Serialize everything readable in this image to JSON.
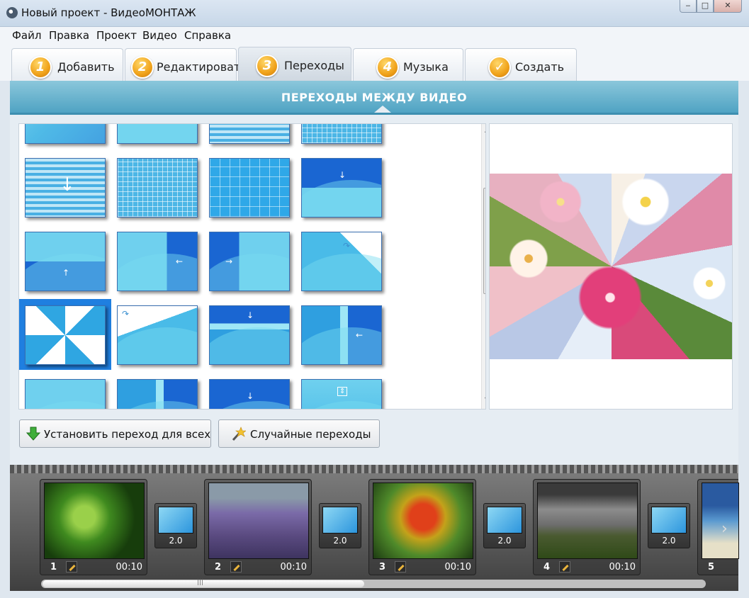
{
  "window": {
    "title": "Новый проект - ВидеоМОНТАЖ",
    "controls": {
      "minimize": "‒",
      "maximize": "□",
      "close": "✕"
    }
  },
  "menu": [
    "Файл",
    "Правка",
    "Проект",
    "Видео",
    "Справка"
  ],
  "tabs": [
    {
      "num": "1",
      "label": "Добавить",
      "active": false
    },
    {
      "num": "2",
      "label": "Редактировать",
      "active": false
    },
    {
      "num": "3",
      "label": "Переходы",
      "active": true
    },
    {
      "num": "4",
      "label": "Музыка",
      "active": false
    },
    {
      "num": "✓",
      "label": "Создать",
      "active": false
    }
  ],
  "section": {
    "title": "ПЕРЕХОДЫ МЕЖДУ ВИДЕО"
  },
  "transitions": {
    "icon_names": [
      "wipe-down-stripes",
      "grid-dissolve",
      "mosaic",
      "slide-down",
      "slide-up",
      "slide-left",
      "slide-right",
      "page-curl",
      "pinwheel",
      "diagonal-wipe",
      "barn-door-down",
      "barn-door-left"
    ],
    "selected": "pinwheel"
  },
  "actions": {
    "apply_all": "Установить переход для всех",
    "random": "Случайные переходы"
  },
  "timeline": {
    "clips": [
      {
        "index": "1",
        "duration": "00:10"
      },
      {
        "index": "2",
        "duration": "00:10"
      },
      {
        "index": "3",
        "duration": "00:10"
      },
      {
        "index": "4",
        "duration": "00:10"
      },
      {
        "index": "5",
        "duration": ""
      }
    ],
    "transitions": [
      "2.0",
      "2.0",
      "2.0",
      "2.0"
    ]
  },
  "colors": {
    "accent": "#4fa3c3",
    "tab_badge": "#f0a21a",
    "selection": "#1f7fe0"
  }
}
